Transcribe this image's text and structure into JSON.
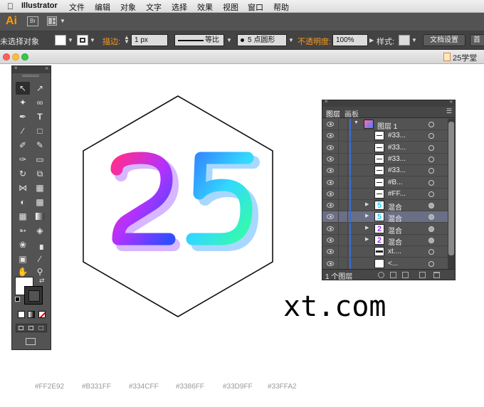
{
  "menubar": {
    "app_name": "Illustrator",
    "items": [
      "文件",
      "编辑",
      "对象",
      "文字",
      "选择",
      "效果",
      "视图",
      "窗口",
      "帮助"
    ]
  },
  "appbar": {
    "logo": "Ai",
    "bridge": "Br"
  },
  "controlbar": {
    "selection_status": "未选择对象",
    "stroke_label": "描边:",
    "stroke_width": "1 px",
    "profile": "等比",
    "brush": "5 点圆形",
    "opacity_label": "不透明度:",
    "opacity_value": "100%",
    "style_label": "样式:",
    "doc_setup": "文档设置",
    "prefs_partial": "首"
  },
  "document": {
    "title": "25学堂"
  },
  "artwork": {
    "number": "25",
    "domain_text": "xt.com",
    "colors": [
      "#FF2E92",
      "#B331FF",
      "#334CFF",
      "#3386FF",
      "#33D9FF",
      "#33FFA2"
    ]
  },
  "layers_panel": {
    "tabs": [
      "图层",
      "画板"
    ],
    "rows": [
      {
        "name": "图层 1",
        "level": 0,
        "expanded": true,
        "thumb": "layer",
        "circle": "empty"
      },
      {
        "name": "#33...",
        "level": 1,
        "thumb": "line",
        "circle": "empty"
      },
      {
        "name": "#33...",
        "level": 1,
        "thumb": "line",
        "circle": "empty"
      },
      {
        "name": "#33...",
        "level": 1,
        "thumb": "line",
        "circle": "empty"
      },
      {
        "name": "#33...",
        "level": 1,
        "thumb": "line",
        "circle": "empty"
      },
      {
        "name": "#B...",
        "level": 1,
        "thumb": "line",
        "circle": "empty"
      },
      {
        "name": "#FF...",
        "level": 1,
        "thumb": "line",
        "circle": "empty"
      },
      {
        "name": "混合",
        "level": 1,
        "collapsed": true,
        "thumb": "five",
        "circle": "filled"
      },
      {
        "name": "混合",
        "level": 1,
        "collapsed": true,
        "thumb": "five",
        "circle": "filled",
        "highlight": true
      },
      {
        "name": "混合",
        "level": 1,
        "collapsed": true,
        "thumb": "two",
        "circle": "filled"
      },
      {
        "name": "混合",
        "level": 1,
        "collapsed": true,
        "thumb": "two",
        "circle": "filled"
      },
      {
        "name": "xt....",
        "level": 1,
        "thumb": "text",
        "circle": "empty"
      },
      {
        "name": "<...",
        "level": 1,
        "thumb": "blank",
        "circle": "empty"
      }
    ],
    "footer_count": "1 个图层"
  },
  "icons": {
    "apple": "apple-icon",
    "selection": "selection-tool-icon",
    "direct_selection": "direct-selection-tool-icon",
    "eye": "eye-icon",
    "trash": "trash-icon"
  }
}
